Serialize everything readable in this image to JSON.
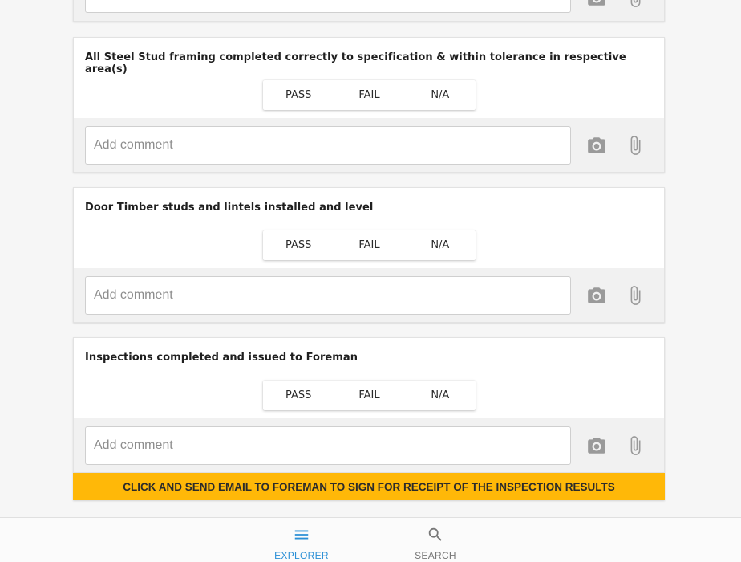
{
  "colors": {
    "accent": "#2a8fd6",
    "email_bar": "#ffb808",
    "icon_grey": "#9a9a9a"
  },
  "segment_labels": {
    "pass": "PASS",
    "fail": "FAIL",
    "na": "N/A"
  },
  "comment_placeholder": "Add comment",
  "questions": [
    {
      "text": "All Steel Stud framing completed correctly to specification & within tolerance in respective area(s)"
    },
    {
      "text": "Door Timber studs and lintels installed and level"
    },
    {
      "text": "Inspections completed and issued to Foreman"
    }
  ],
  "email_bar_label": "CLICK AND SEND EMAIL TO FOREMAN TO SIGN FOR RECEIPT OF THE INSPECTION RESULTS",
  "bottom_nav": {
    "explorer": {
      "label": "EXPLORER",
      "icon": "menu-icon",
      "active": true
    },
    "search": {
      "label": "SEARCH",
      "icon": "search-icon",
      "active": false
    }
  }
}
